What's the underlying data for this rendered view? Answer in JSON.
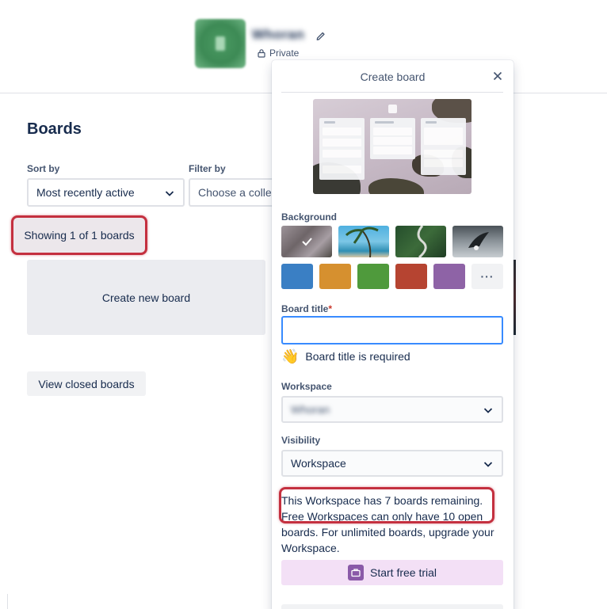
{
  "workspace": {
    "name": "Whoran",
    "privacy": "Private"
  },
  "boards_page": {
    "title": "Boards",
    "sort_by_label": "Sort by",
    "sort_by_value": "Most recently active",
    "filter_by_label": "Filter by",
    "filter_placeholder": "Choose a colle",
    "showing_text": "Showing 1 of 1 boards",
    "create_new_board": "Create new board",
    "view_closed_boards": "View closed boards"
  },
  "create_board": {
    "title": "Create board",
    "background_label": "Background",
    "background_photos": [
      "snowy-mountain-photo",
      "tropical-beach-photo",
      "forest-road-photo",
      "eagle-sky-photo"
    ],
    "background_colors": [
      "#3a7fc4",
      "#d6902f",
      "#4f9a3c",
      "#b64431",
      "#8e63a6"
    ],
    "more_label": "···",
    "board_title_label": "Board title",
    "required_mark": "*",
    "board_title_value": "",
    "required_emoji": "👋",
    "required_message": "Board title is required",
    "workspace_label": "Workspace",
    "workspace_value": "Whoran",
    "visibility_label": "Visibility",
    "visibility_value": "Workspace",
    "limit_message": "This Workspace has 7 boards remaining. Free Workspaces can only have 10 open boards. For unlimited boards, upgrade your Workspace.",
    "trial_button": "Start free trial"
  },
  "colors": {
    "highlight": "#c4303f",
    "focus": "#388bff",
    "trial_bg": "#f3e0f6"
  }
}
